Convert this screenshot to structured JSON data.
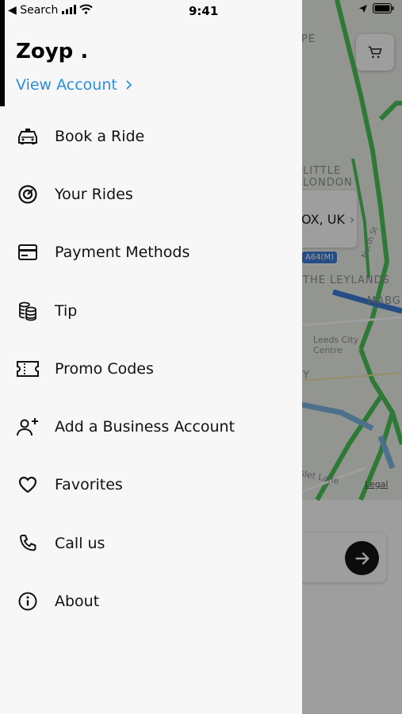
{
  "status_bar": {
    "back_label": "◀ Search",
    "time": "9:41"
  },
  "map": {
    "labels": [
      "PE",
      "LITTLE",
      "LONDON",
      "THE LEYLANDS",
      "MABG",
      "Leeds City",
      "Centre",
      "North St",
      "slet Lane",
      "Y"
    ],
    "address_text": "OX, UK",
    "road_shield": "A64(M)",
    "legal": "Legal"
  },
  "drawer": {
    "user_name": "Zoyp .",
    "view_account": "View Account",
    "menu": [
      {
        "label": "Book a Ride",
        "icon": "taxi-icon"
      },
      {
        "label": "Your Rides",
        "icon": "rides-history-icon"
      },
      {
        "label": "Payment Methods",
        "icon": "credit-card-icon"
      },
      {
        "label": "Tip",
        "icon": "coins-icon"
      },
      {
        "label": "Promo Codes",
        "icon": "ticket-icon"
      },
      {
        "label": "Add a Business Account",
        "icon": "add-user-icon"
      },
      {
        "label": "Favorites",
        "icon": "heart-icon"
      },
      {
        "label": "Call us",
        "icon": "phone-icon"
      },
      {
        "label": "About",
        "icon": "info-icon"
      }
    ]
  },
  "colors": {
    "accent_link": "#2b8fdc",
    "drawer_bg": "#f7f7f7",
    "route_green": "#4cc35a",
    "route_blue": "#3f7dd8"
  }
}
